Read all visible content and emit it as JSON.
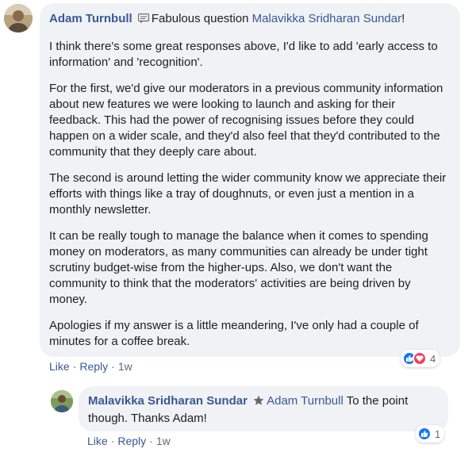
{
  "comment": {
    "author": "Adam Turnbull",
    "mention": "Malavikka Sridharan Sundar",
    "intro_text": "Fabulous question ",
    "intro_end": "!",
    "paragraphs": [
      "I think there's some great responses above, I'd like to add 'early access to information' and 'recognition'.",
      "For the first, we'd give our moderators in a previous community information about new features we were looking to launch and asking for their feedback. This had the power of recognising issues before they could happen on a wider scale, and they'd also feel that they'd contributed to the community that they deeply care about.",
      "The second is around letting the wider community know we appreciate their efforts with things like a tray of doughnuts, or even just a mention in a monthly newsletter.",
      "It can be really tough to manage the balance when it comes to spending money on moderators, as many communities can already be under tight scrutiny budget-wise from the higher-ups. Also, we don't want the community to think that the moderators' activities are being driven by money.",
      "Apologies if my answer is a little meandering, I've only had a couple of minutes for a coffee break."
    ],
    "like_label": "Like",
    "reply_label": "Reply",
    "time": "1w",
    "reaction_count": "4",
    "reaction_icons": [
      "like-icon",
      "love-icon"
    ],
    "author_badge_icon": "message-icon"
  },
  "reply": {
    "author": "Malavikka Sridharan Sundar",
    "mention": "Adam Turnbull",
    "text_line1": " To the point",
    "text_line2": "though. Thanks Adam!",
    "like_label": "Like",
    "reply_label": "Reply",
    "time": "1w",
    "reaction_count": "1",
    "reaction_icons": [
      "like-icon"
    ],
    "author_badge_icon": "star-icon"
  },
  "colors": {
    "link": "#385898",
    "bubble": "#f0f2f5",
    "like": "#1877f2",
    "love": "#f33e58"
  }
}
